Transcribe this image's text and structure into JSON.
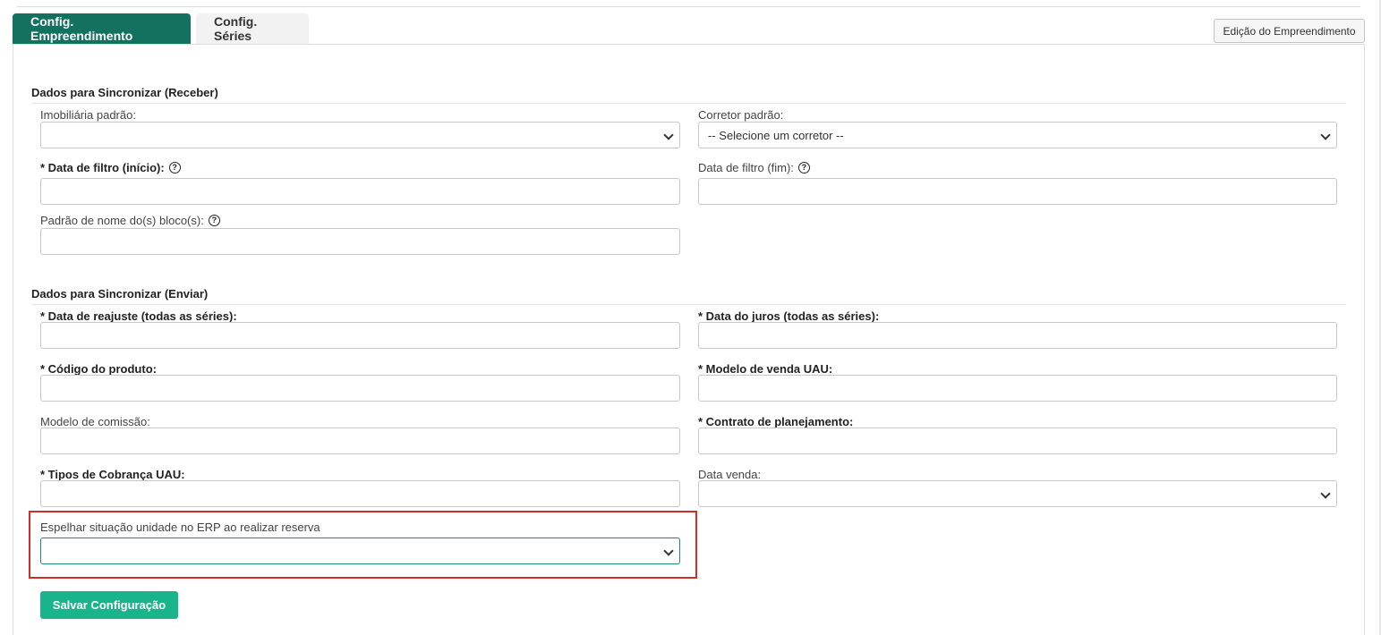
{
  "tabs": {
    "active": "Config. Empreendimento",
    "inactive": "Config. Séries"
  },
  "edit_button": "Edição do Empreendimento",
  "receive_section": {
    "title": "Dados para Sincronizar (Receber)",
    "imobiliaria_label": "Imobiliária padrão:",
    "imobiliaria_value": "",
    "corretor_label": "Corretor padrão:",
    "corretor_value": "-- Selecione um corretor --",
    "data_inicio_label": "* Data de filtro (início):",
    "data_fim_label": "Data de filtro (fim):",
    "bloco_label": "Padrão de nome do(s) bloco(s):"
  },
  "send_section": {
    "title": "Dados para Sincronizar (Enviar)",
    "reajuste_label": "* Data de reajuste (todas as séries):",
    "juros_label": "* Data do juros (todas as séries):",
    "produto_label": "* Código do produto:",
    "modelo_venda_label": "* Modelo de venda UAU:",
    "comissao_label": "Modelo de comissão:",
    "contrato_label": "* Contrato de planejamento:",
    "cobranca_label": "* Tipos de Cobrança UAU:",
    "data_venda_label": "Data venda:",
    "espelhar_label": "Espelhar situação unidade no ERP ao realizar reserva"
  },
  "save_button": "Salvar Configuração",
  "colors": {
    "primary": "#12715f",
    "save": "#19b48a",
    "highlight": "#d32d2d"
  },
  "icons": {
    "help": "question-circle-icon",
    "dropdown": "chevron-down-icon"
  }
}
